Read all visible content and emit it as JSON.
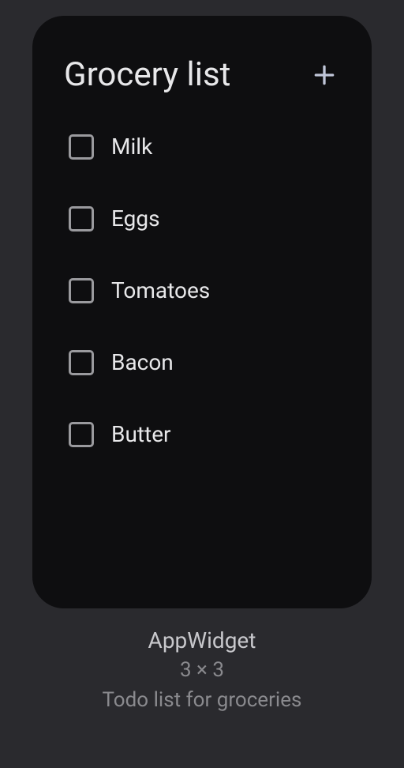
{
  "widget": {
    "title": "Grocery list",
    "items": [
      {
        "label": "Milk"
      },
      {
        "label": "Eggs"
      },
      {
        "label": "Tomatoes"
      },
      {
        "label": "Bacon"
      },
      {
        "label": "Butter"
      }
    ]
  },
  "info": {
    "name": "AppWidget",
    "size": "3 × 3",
    "description": "Todo list for groceries"
  }
}
